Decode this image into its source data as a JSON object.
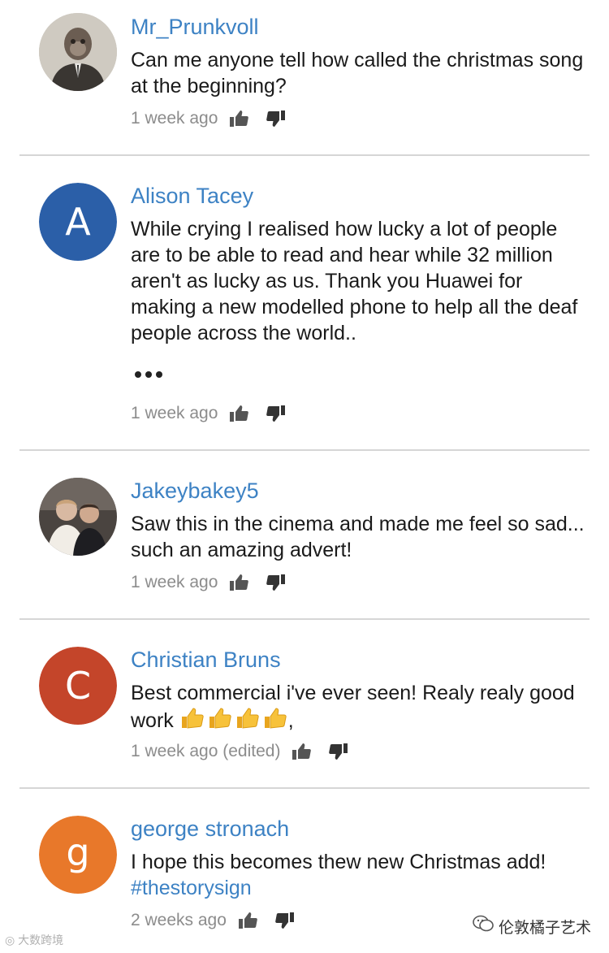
{
  "comments": [
    {
      "author": "Mr_Prunkvoll",
      "avatar_type": "photo",
      "text": "Can me anyone tell how called the christmas song at the beginning?",
      "time": "1 week ago"
    },
    {
      "author": "Alison Tacey",
      "avatar_type": "letter",
      "avatar_letter": "A",
      "avatar_color": "#2b5fa8",
      "text": "While crying I realised how lucky a lot of people are to be able to read and hear while 32 million aren't as lucky as us. Thank you Huawei for making a new modelled phone to help all the deaf people across the world..",
      "more_icon": "ellipsis-icon",
      "time": "1 week ago"
    },
    {
      "author": "Jakeybakey5",
      "avatar_type": "photo",
      "text": "Saw this in the cinema and made me feel so sad... such an amazing advert!",
      "time": "1 week ago"
    },
    {
      "author": "Christian Bruns",
      "avatar_type": "letter",
      "avatar_letter": "C",
      "avatar_color": "#c4452a",
      "text": "Best commercial i've ever seen! Realy realy good work",
      "text_suffix": ",",
      "time": "1 week ago (edited)"
    },
    {
      "author": "george stronach",
      "avatar_type": "letter",
      "avatar_letter": "g",
      "avatar_color": "#e8782a",
      "text": "I hope this becomes thew new Christmas add!",
      "hashtag": "#thestorysign",
      "time": "2 weeks ago"
    }
  ],
  "icons": {
    "like": "thumbs-up-icon",
    "dislike": "thumbs-down-icon"
  },
  "colors": {
    "author": "#3d82c4",
    "text": "#1a1a1a",
    "meta": "#8c8c8c",
    "divider": "#d6d6d6"
  },
  "watermarks": {
    "left": "大数跨境",
    "right": "伦敦橘子艺术"
  }
}
